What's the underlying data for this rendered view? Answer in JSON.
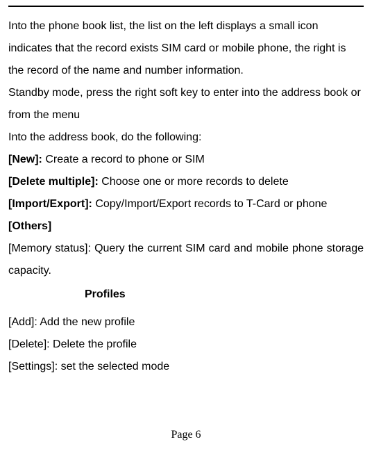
{
  "body": {
    "p1": "Into the phone book list, the list on the left displays a small icon indicates that the record exists SIM card or mobile phone, the right is the record of the name and number information.",
    "p2": "Standby mode, press the right soft key to enter into the address book or from the menu",
    "p3": "Into the address book, do the following:",
    "new_label": "[New]: ",
    "new_desc": "Create a record to phone or SIM",
    "delmul_label": "[Delete multiple]: ",
    "delmul_desc": "Choose one or more records to delete",
    "impexp_label": "[Import/Export]: ",
    "impexp_desc": "Copy/Import/Export records to T-Card or phone",
    "others_label": "[Others]",
    "memstatus": "[Memory status]: Query the current SIM card and mobile phone storage capacity.",
    "profiles_heading": "Profiles",
    "add_line": "[Add]: Add the new profile",
    "delete_line": "[Delete]: Delete the profile",
    "settings_line": "[Settings]: set the selected mode"
  },
  "footer": {
    "page_label": "Page 6"
  }
}
